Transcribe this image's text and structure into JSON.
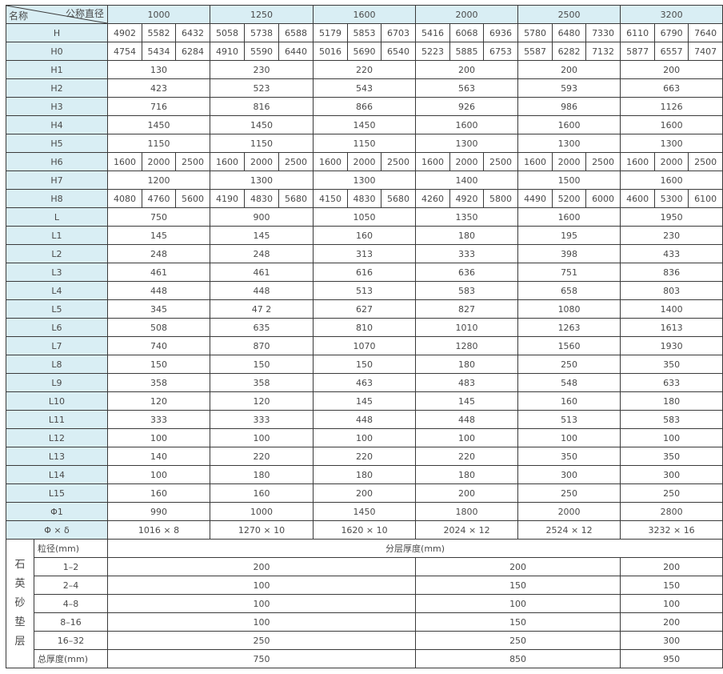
{
  "header": {
    "corner_top": "公称直径",
    "corner_bottom": "名称",
    "diameters": [
      "1000",
      "1250",
      "1600",
      "2000",
      "2500",
      "3200"
    ]
  },
  "rows": [
    {
      "name": "H",
      "cells": [
        [
          "4902",
          "5582",
          "6432"
        ],
        [
          "5058",
          "5738",
          "6588"
        ],
        [
          "5179",
          "5853",
          "6703"
        ],
        [
          "5416",
          "6068",
          "6936"
        ],
        [
          "5780",
          "6480",
          "7330"
        ],
        [
          "6110",
          "6790",
          "7640"
        ]
      ]
    },
    {
      "name": "H0",
      "cells": [
        [
          "4754",
          "5434",
          "6284"
        ],
        [
          "4910",
          "5590",
          "6440"
        ],
        [
          "5016",
          "5690",
          "6540"
        ],
        [
          "5223",
          "5885",
          "6753"
        ],
        [
          "5587",
          "6282",
          "7132"
        ],
        [
          "5877",
          "6557",
          "7407"
        ]
      ]
    },
    {
      "name": "H1",
      "cells": [
        "130",
        "230",
        "220",
        "200",
        "200",
        "200"
      ]
    },
    {
      "name": "H2",
      "cells": [
        "423",
        "523",
        "543",
        "563",
        "593",
        "663"
      ]
    },
    {
      "name": "H3",
      "cells": [
        "716",
        "816",
        "866",
        "926",
        "986",
        "1126"
      ]
    },
    {
      "name": "H4",
      "cells": [
        "1450",
        "1450",
        "1450",
        "1600",
        "1600",
        "1600"
      ]
    },
    {
      "name": "H5",
      "cells": [
        "1150",
        "1150",
        "1150",
        "1300",
        "1300",
        "1300"
      ]
    },
    {
      "name": "H6",
      "cells": [
        [
          "1600",
          "2000",
          "2500"
        ],
        [
          "1600",
          "2000",
          "2500"
        ],
        [
          "1600",
          "2000",
          "2500"
        ],
        [
          "1600",
          "2000",
          "2500"
        ],
        [
          "1600",
          "2000",
          "2500"
        ],
        [
          "1600",
          "2000",
          "2500"
        ]
      ]
    },
    {
      "name": "H7",
      "cells": [
        "1200",
        "1300",
        "1300",
        "1400",
        "1500",
        "1600"
      ]
    },
    {
      "name": "H8",
      "cells": [
        [
          "4080",
          "4760",
          "5600"
        ],
        [
          "4190",
          "4830",
          "5680"
        ],
        [
          "4150",
          "4830",
          "5680"
        ],
        [
          "4260",
          "4920",
          "5800"
        ],
        [
          "4490",
          "5200",
          "6000"
        ],
        [
          "4600",
          "5300",
          "6100"
        ]
      ]
    },
    {
      "name": "L",
      "cells": [
        "750",
        "900",
        "1050",
        "1350",
        "1600",
        "1950"
      ]
    },
    {
      "name": "L1",
      "cells": [
        "145",
        "145",
        "160",
        "180",
        "195",
        "230"
      ]
    },
    {
      "name": "L2",
      "cells": [
        "248",
        "248",
        "313",
        "333",
        "398",
        "433"
      ]
    },
    {
      "name": "L3",
      "cells": [
        "461",
        "461",
        "616",
        "636",
        "751",
        "836"
      ]
    },
    {
      "name": "L4",
      "cells": [
        "448",
        "448",
        "513",
        "583",
        "658",
        "803"
      ]
    },
    {
      "name": "L5",
      "cells": [
        "345",
        "47 2",
        "627",
        "827",
        "1080",
        "1400"
      ]
    },
    {
      "name": "L6",
      "cells": [
        "508",
        "635",
        "810",
        "1010",
        "1263",
        "1613"
      ]
    },
    {
      "name": "L7",
      "cells": [
        "740",
        "870",
        "1070",
        "1280",
        "1560",
        "1930"
      ]
    },
    {
      "name": "L8",
      "cells": [
        "150",
        "150",
        "150",
        "180",
        "250",
        "350"
      ]
    },
    {
      "name": "L9",
      "cells": [
        "358",
        "358",
        "463",
        "483",
        "548",
        "633"
      ]
    },
    {
      "name": "L10",
      "cells": [
        "120",
        "120",
        "145",
        "145",
        "160",
        "180"
      ]
    },
    {
      "name": "L11",
      "cells": [
        "333",
        "333",
        "448",
        "448",
        "513",
        "583"
      ]
    },
    {
      "name": "L12",
      "cells": [
        "100",
        "100",
        "100",
        "100",
        "100",
        "100"
      ]
    },
    {
      "name": "L13",
      "cells": [
        "140",
        "220",
        "220",
        "220",
        "350",
        "350"
      ]
    },
    {
      "name": "L14",
      "cells": [
        "100",
        "180",
        "180",
        "180",
        "300",
        "300"
      ]
    },
    {
      "name": "L15",
      "cells": [
        "160",
        "160",
        "200",
        "200",
        "250",
        "250"
      ]
    },
    {
      "name": "Φ1",
      "cells": [
        "990",
        "1000",
        "1450",
        "1800",
        "2000",
        "2800"
      ]
    },
    {
      "name": "Φ × δ",
      "cells": [
        "1016 × 8",
        "1270 × 10",
        "1620 × 10",
        "2024 × 12",
        "2524 × 12",
        "3232 × 16"
      ]
    }
  ],
  "quartz": {
    "label_chars": [
      "石",
      "英",
      "砂",
      "垫",
      "层"
    ],
    "grain_header": "粒径(mm)",
    "thickness_header": "分层厚度(mm)",
    "rows": [
      {
        "grain": "1–2",
        "values": [
          "200",
          "200",
          "200"
        ]
      },
      {
        "grain": "2–4",
        "values": [
          "100",
          "150",
          "150"
        ]
      },
      {
        "grain": "4–8",
        "values": [
          "100",
          "100",
          "100"
        ]
      },
      {
        "grain": "8–16",
        "values": [
          "100",
          "150",
          "200"
        ]
      },
      {
        "grain": "16–32",
        "values": [
          "250",
          "250",
          "300"
        ]
      }
    ],
    "total_label": "总厚度(mm)",
    "total_values": [
      "750",
      "850",
      "950"
    ]
  }
}
